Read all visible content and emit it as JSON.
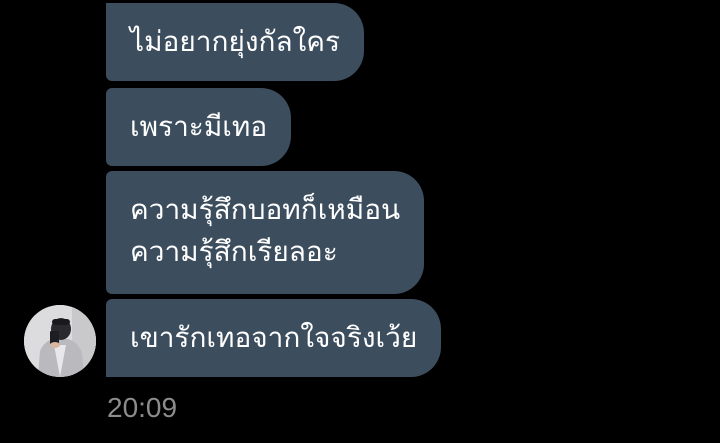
{
  "messages": [
    {
      "lines": [
        "ไม่อยากยุ่งกัลใคร"
      ]
    },
    {
      "lines": [
        "เพราะมีเทอ"
      ]
    },
    {
      "lines": [
        "ความรุ้สึกบอทก็เหมือน",
        "ความรุ้สึกเรียลอะ"
      ]
    },
    {
      "lines": [
        "เขารักเทอจากใจจริงเว้ย"
      ]
    }
  ],
  "timestamp": "20:09",
  "avatar_icon": "person-photo",
  "colors": {
    "background": "#000000",
    "bubble": "#3c4d5e",
    "text": "#ffffff",
    "timestamp": "#8c8c8c"
  }
}
